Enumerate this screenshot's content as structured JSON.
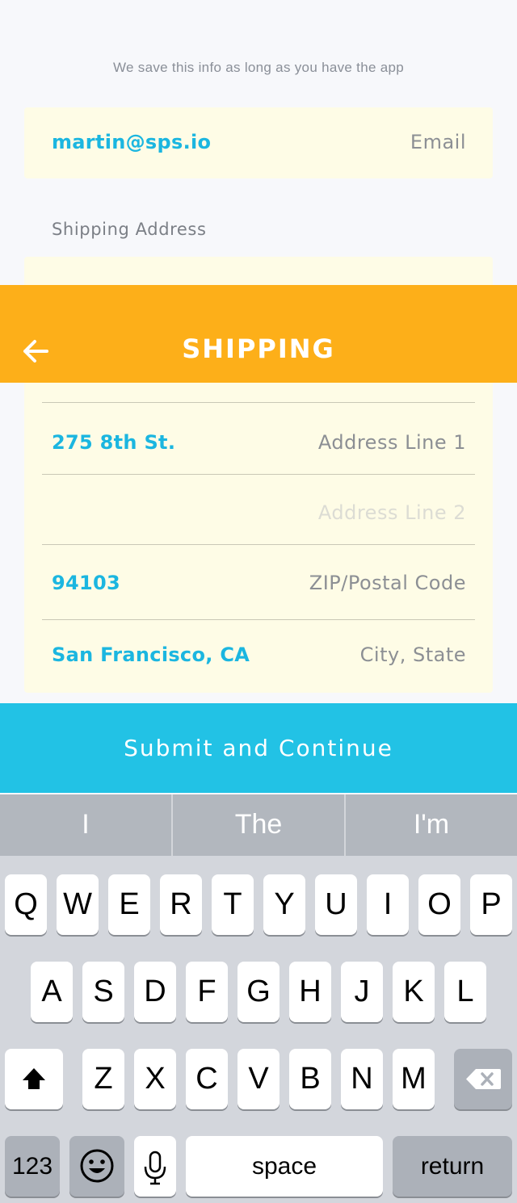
{
  "hint": "We save this info as long as you have the app",
  "email": {
    "value": "martin@sps.io",
    "placeholder": "Email"
  },
  "shipping_label": "Shipping Address",
  "header": {
    "title": "SHIPPING"
  },
  "address": {
    "line1": {
      "value": "275 8th St.",
      "placeholder": "Address Line 1"
    },
    "line2": {
      "value": "",
      "placeholder": "Address Line 2"
    },
    "zip": {
      "value": "94103",
      "placeholder": "ZIP/Postal Code"
    },
    "city": {
      "value": "San Francisco, CA",
      "placeholder": "City, State"
    }
  },
  "submit_label": "Submit and Continue",
  "suggestions": [
    "I",
    "The",
    "I'm"
  ],
  "keyboard": {
    "row1": [
      "Q",
      "W",
      "E",
      "R",
      "T",
      "Y",
      "U",
      "I",
      "O",
      "P"
    ],
    "row2": [
      "A",
      "S",
      "D",
      "F",
      "G",
      "H",
      "J",
      "K",
      "L"
    ],
    "row3": [
      "Z",
      "X",
      "C",
      "V",
      "B",
      "N",
      "M"
    ],
    "numbers_label": "123",
    "space_label": "space",
    "return_label": "return"
  },
  "colors": {
    "header": "#fdaf19",
    "accent": "#1bb6e0",
    "submit": "#22c2e5",
    "card": "#fefce6"
  }
}
